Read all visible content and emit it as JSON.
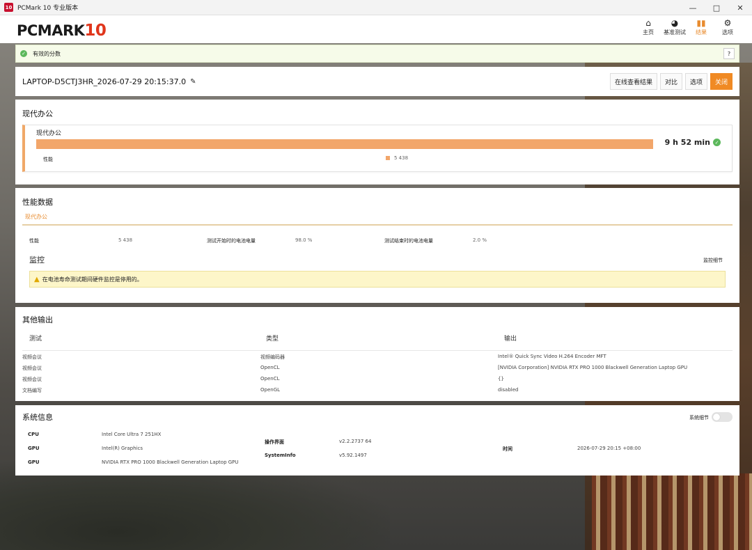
{
  "window": {
    "title": "PCMark 10 专业版本",
    "app_icon_text": "10"
  },
  "logo": {
    "text": "PCMARK",
    "number": "10"
  },
  "nav": [
    {
      "label": "主页",
      "icon": "home-icon"
    },
    {
      "label": "基准测试",
      "icon": "gauge-icon"
    },
    {
      "label": "结果",
      "icon": "bar-chart-icon"
    },
    {
      "label": "选项",
      "icon": "gear-icon"
    }
  ],
  "status": {
    "text": "有效的分数",
    "help": "?"
  },
  "result": {
    "title": "LAPTOP-D5CTJ3HR_2026-07-29 20:15:37.0",
    "buttons": {
      "online": "在线查看结果",
      "compare": "对比",
      "options": "选项",
      "close": "关闭"
    }
  },
  "modern_office": {
    "heading": "现代办公",
    "card_title": "现代办公",
    "value": "9 h 52 min",
    "sub_label": "性能",
    "legend_value": "5 438",
    "progress": 1.0
  },
  "perf": {
    "heading": "性能数据",
    "tab": "现代办公",
    "items": [
      {
        "k": "性能",
        "v": "5 438"
      },
      {
        "k": "测试开始时的电池电量",
        "v": "98.0 %"
      },
      {
        "k": "测试结束时的电池电量",
        "v": "2.0 %"
      }
    ],
    "monitor_title": "监控",
    "monitor_link": "监控细节",
    "warning": "在电池寿命测试期间硬件监控是停用的。"
  },
  "other": {
    "heading": "其他输出",
    "headers": [
      "测试",
      "类型",
      "输出"
    ],
    "rows": [
      [
        "视频会议",
        "视频编码器",
        "Intel® Quick Sync Video H.264 Encoder MFT"
      ],
      [
        "视频会议",
        "OpenCL",
        "[NVIDIA Corporation] NVIDIA RTX PRO 1000 Blackwell Generation Laptop GPU"
      ],
      [
        "视频会议",
        "OpenCL",
        "{}"
      ],
      [
        "文档编写",
        "OpenGL",
        "disabled"
      ]
    ]
  },
  "sysinfo": {
    "heading": "系统信息",
    "toggle_label": "系统细节",
    "col1": [
      {
        "k": "CPU",
        "v": "Intel Core Ultra 7 251HX"
      },
      {
        "k": "GPU",
        "v": "Intel(R) Graphics"
      },
      {
        "k": "GPU",
        "v": "NVIDIA RTX PRO 1000 Blackwell Generation Laptop GPU"
      }
    ],
    "col2": [
      {
        "k": "操作界面",
        "v": "v2.2.2737 64"
      },
      {
        "k": "SystemInfo",
        "v": "v5.92.1497"
      }
    ],
    "col3": [
      {
        "k": "时间",
        "v": "2026-07-29 20:15 +08:00"
      }
    ]
  }
}
